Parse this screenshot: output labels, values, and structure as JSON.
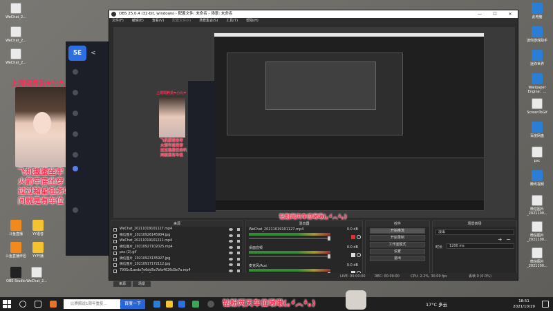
{
  "desktop": {
    "left_icons": [
      {
        "label": "WeChat_2..."
      },
      {
        "label": "WeChat_2..."
      },
      {
        "label": "WeChat_2..."
      },
      {
        "label": "斗鱼直播"
      },
      {
        "label": "YY语音"
      },
      {
        "label": "斗鱼直播伴侣"
      },
      {
        "label": "YY开播"
      },
      {
        "label": "OBS Studio"
      },
      {
        "label": "WeChat_2..."
      }
    ],
    "right_icons": [
      {
        "label": "此电脑"
      },
      {
        "label": "迷你游戏助手"
      },
      {
        "label": "迷你世界"
      },
      {
        "label": "Wallpaper Engine：..."
      },
      {
        "label": "ScreenToGif"
      },
      {
        "label": "百度网盘"
      },
      {
        "label": "pxc"
      },
      {
        "label": "腾讯视频"
      },
      {
        "label": "微信图片_2021100..."
      },
      {
        "label": "微信图片_2021100..."
      },
      {
        "label": "微信图片_2021100..."
      }
    ]
  },
  "overlay": {
    "title": "上周饲养员❤小九❤",
    "lines": [
      "飞机握蜜坐牢",
      "火箭牢底坐穿",
      "过过箱星任务叭",
      "间就是有车位"
    ]
  },
  "panel5e": {
    "logo": "5E",
    "arrow": "<"
  },
  "obs": {
    "title": "OBS 25.0.4 (32-bit, windows) - 配置文件: 未命名 - 场景: 未命名",
    "win_controls": [
      "—",
      "☐",
      "✕"
    ],
    "menu": [
      "文件(F)",
      "编辑(E)",
      "查看(V)",
      "配置文件(P)",
      "场景集合(S)",
      "工具(T)",
      "帮助(H)"
    ],
    "preview_caption": "钻粉两天车位啾啾(｡•́︿•̀｡)",
    "sources": {
      "header": "来源",
      "items": [
        "WeChat_20211019101127.mp4",
        "微信图片_20210926145904.jpg",
        "WeChat_20211019101211.mp4",
        "微信图片_20210927102025.mp4",
        "pxc (2).gif",
        "微信图片_20210923135927.jpg",
        "微信图片_20210917172112.jpg",
        "790Scl1aeda7e6dd5e7bfa4626d3e7a.mp4"
      ]
    },
    "mixer": {
      "header": "混音器",
      "channels": [
        {
          "name": "WeChat_20211019101127.mp4",
          "db": "0.0 dB"
        },
        {
          "name": "桌面音频",
          "db": "0.0 dB"
        },
        {
          "name": "麦克风/Aux",
          "db": "0.0 dB"
        }
      ]
    },
    "controls": {
      "header": "控件",
      "buttons": [
        "开始推流",
        "开始录制",
        "工作室模式",
        "设置",
        "退出"
      ]
    },
    "transitions": {
      "header": "场景转场",
      "type": "淡出",
      "duration_label": "时长",
      "duration_value": "1200 ms"
    },
    "dock_tabs": [
      "来源",
      "场景"
    ],
    "status": {
      "live": "LIVE: 00:00:00",
      "rec": "REC: 00:00:00",
      "cpu": "CPU: 2.2%, 30.00 fps",
      "dropped": "丢帧 0 (0.0%)"
    }
  },
  "caption": "钻粉两天车位啾啾(｡•́︿•̀｡)",
  "taskbar": {
    "search_placeholder": "比赛解说1周年重复...",
    "search_button": "百度一下",
    "weather": "17°C 多云",
    "time": "18:51",
    "date": "2021/10/19"
  }
}
